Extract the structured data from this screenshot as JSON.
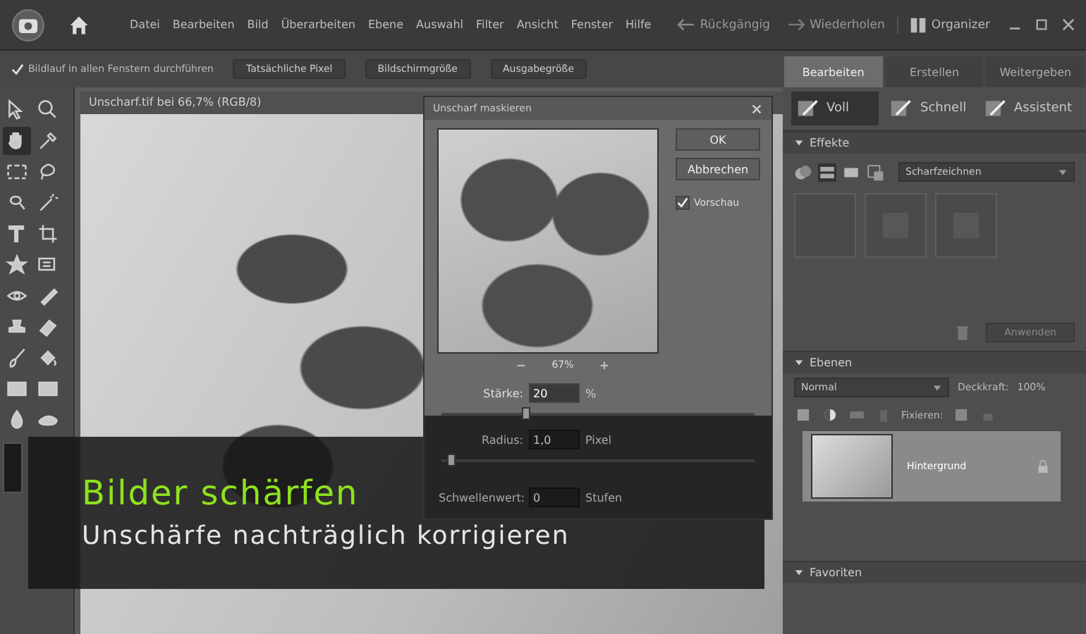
{
  "menu_bar": {
    "items": [
      "Datei",
      "Bearbeiten",
      "Bild",
      "Überarbeiten",
      "Ebene",
      "Auswahl",
      "Filter",
      "Ansicht",
      "Fenster",
      "Hilfe"
    ],
    "undo": "Rückgängig",
    "redo": "Wiederholen",
    "organizer": "Organizer"
  },
  "options_bar": {
    "scroll_all": {
      "label": "Bildlauf in allen Fenstern durchführen",
      "checked": true
    },
    "buttons": [
      "Tatsächliche Pixel",
      "Bildschirmgröße",
      "Ausgabegröße"
    ]
  },
  "tools": [
    {
      "kind": "move",
      "selected": false
    },
    {
      "kind": "zoom",
      "selected": false
    },
    {
      "kind": "hand",
      "selected": true
    },
    {
      "kind": "eyedropper",
      "selected": false
    },
    {
      "kind": "marquee",
      "selected": false
    },
    {
      "kind": "lasso",
      "selected": false
    },
    {
      "kind": "quickselect",
      "selected": false
    },
    {
      "kind": "wand",
      "selected": false
    },
    {
      "kind": "type",
      "selected": false
    },
    {
      "kind": "crop",
      "selected": false
    },
    {
      "kind": "shape",
      "selected": false
    },
    {
      "kind": "recompose",
      "selected": false
    },
    {
      "kind": "redeye",
      "selected": false
    },
    {
      "kind": "healing",
      "selected": false
    },
    {
      "kind": "stamp",
      "selected": false
    },
    {
      "kind": "eraser",
      "selected": false
    },
    {
      "kind": "brush",
      "selected": false
    },
    {
      "kind": "bucket",
      "selected": false
    },
    {
      "kind": "gradient",
      "selected": false
    },
    {
      "kind": "gradient2",
      "selected": false
    },
    {
      "kind": "drop",
      "selected": false
    },
    {
      "kind": "sponge",
      "selected": false
    }
  ],
  "document": {
    "title": "Unscharf.tif bei 66,7% (RGB/8)"
  },
  "dialog": {
    "title": "Unscharf maskieren",
    "ok": "OK",
    "cancel": "Abbrechen",
    "preview": {
      "label": "Vorschau",
      "checked": true
    },
    "zoom": "67%",
    "fields": [
      {
        "label": "Stärke:",
        "value": "20",
        "unit": "%",
        "level": 0.27,
        "active": true
      },
      {
        "label": "Radius:",
        "value": "1,0",
        "unit": "Pixel",
        "level": 0.03,
        "active": false
      },
      {
        "label": "Schwellenwert:",
        "value": "0",
        "unit": "Stufen",
        "active": false
      }
    ]
  },
  "panel": {
    "mode_tabs": [
      {
        "label": "Bearbeiten",
        "selected": true
      },
      {
        "label": "Erstellen",
        "selected": false
      },
      {
        "label": "Weitergeben",
        "selected": false
      }
    ],
    "edit_modes": [
      {
        "label": "Voll",
        "selected": true
      },
      {
        "label": "Schnell",
        "selected": false
      },
      {
        "label": "Assistent",
        "selected": false
      }
    ],
    "effects": {
      "title": "Effekte",
      "category": "Scharfzeichnen",
      "apply": "Anwenden"
    },
    "layers": {
      "title": "Ebenen",
      "blend_mode": "Normal",
      "opacity_label": "Deckkraft:",
      "opacity": "100%",
      "lock_label": "Fixieren:",
      "items": [
        {
          "name": "Hintergrund",
          "selected": true
        }
      ]
    },
    "favorites": {
      "title": "Favoriten"
    }
  },
  "caption": {
    "title": "Bilder schärfen",
    "subtitle": "Unschärfe nachträglich korrigieren"
  }
}
